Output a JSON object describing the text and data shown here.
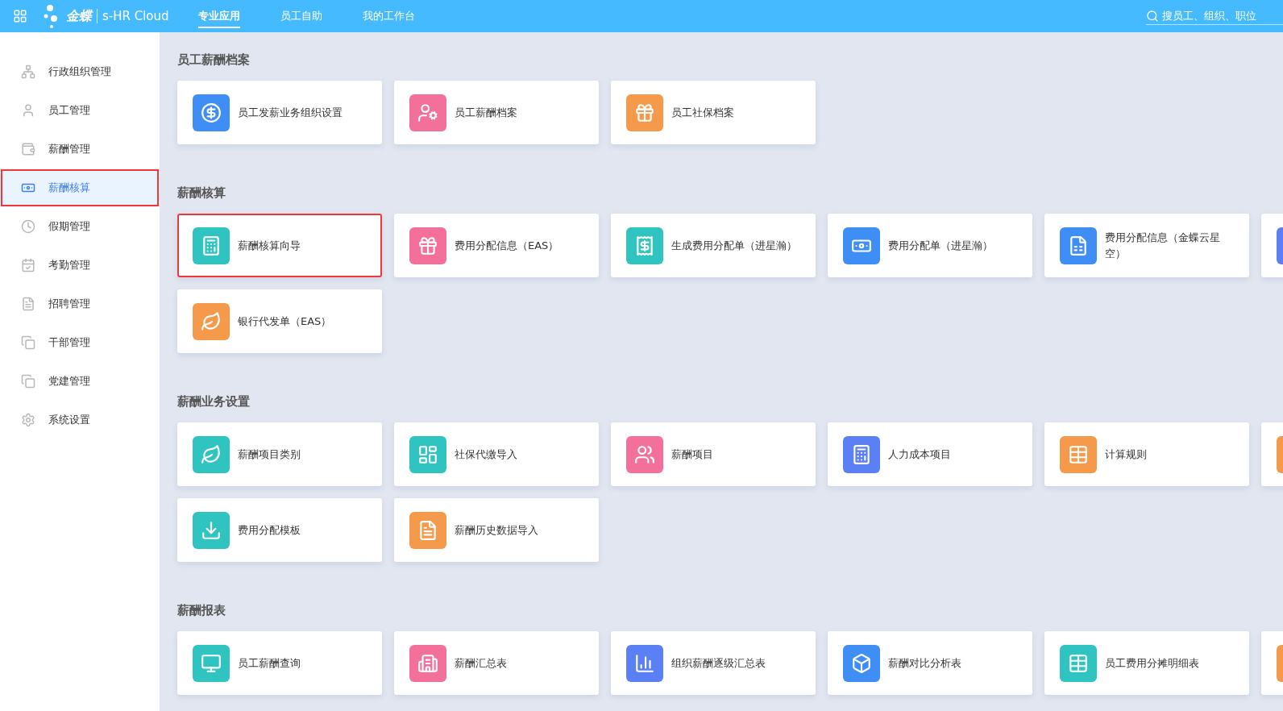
{
  "header": {
    "logo_brand": "金蝶",
    "logo_product": "s-HR Cloud",
    "tabs": [
      {
        "label": "专业应用",
        "selected": true
      },
      {
        "label": "员工自助",
        "selected": false
      },
      {
        "label": "我的工作台",
        "selected": false
      }
    ],
    "search": {
      "placeholder": "搜员工、组织、职位"
    }
  },
  "sidebar": {
    "items": [
      {
        "label": "行政组织管理",
        "selected": false,
        "highlighted": false
      },
      {
        "label": "员工管理",
        "selected": false,
        "highlighted": false
      },
      {
        "label": "薪酬管理",
        "selected": false,
        "highlighted": false
      },
      {
        "label": "薪酬核算",
        "selected": true,
        "highlighted": true
      },
      {
        "label": "假期管理",
        "selected": false,
        "highlighted": false
      },
      {
        "label": "考勤管理",
        "selected": false,
        "highlighted": false
      },
      {
        "label": "招聘管理",
        "selected": false,
        "highlighted": false
      },
      {
        "label": "干部管理",
        "selected": false,
        "highlighted": false
      },
      {
        "label": "党建管理",
        "selected": false,
        "highlighted": false
      },
      {
        "label": "系统设置",
        "selected": false,
        "highlighted": false
      }
    ]
  },
  "sections": [
    {
      "title": "员工薪酬档案",
      "cards": [
        {
          "kind": "app",
          "label": "员工发薪业务组织设置",
          "color": "#3f8ef5",
          "highlighted": false
        },
        {
          "kind": "app",
          "label": "员工薪酬档案",
          "color": "#f2709a",
          "highlighted": false
        },
        {
          "kind": "app",
          "label": "员工社保档案",
          "color": "#f5994a",
          "highlighted": false
        }
      ]
    },
    {
      "title": "薪酬核算",
      "cards": [
        {
          "kind": "app",
          "label": "薪酬核算向导",
          "color": "#2fc4c0",
          "highlighted": true
        },
        {
          "kind": "app",
          "label": "费用分配信息（EAS）",
          "color": "#f2709a",
          "highlighted": false
        },
        {
          "kind": "app",
          "label": "生成费用分配单（进星瀚）",
          "color": "#2fc4c0",
          "highlighted": false
        },
        {
          "kind": "app",
          "label": "费用分配单（进星瀚）",
          "color": "#3f8ef5",
          "highlighted": false
        },
        {
          "kind": "app",
          "label": "费用分配信息（金蝶云星空）",
          "color": "#3f8ef5",
          "highlighted": false
        },
        {
          "kind": "clipped",
          "color": "#5b7ff5",
          "highlighted": false
        },
        {
          "kind": "app",
          "label": "银行代发单（EAS）",
          "color": "#f5994a",
          "highlighted": false
        }
      ]
    },
    {
      "title": "薪酬业务设置",
      "cards": [
        {
          "kind": "app",
          "label": "薪酬项目类别",
          "color": "#2fc4c0",
          "highlighted": false
        },
        {
          "kind": "app",
          "label": "社保代缴导入",
          "color": "#2fc4c0",
          "highlighted": false
        },
        {
          "kind": "app",
          "label": "薪酬项目",
          "color": "#f2709a",
          "highlighted": false
        },
        {
          "kind": "app",
          "label": "人力成本项目",
          "color": "#5b7ff5",
          "highlighted": false
        },
        {
          "kind": "app",
          "label": "计算规则",
          "color": "#f5994a",
          "highlighted": false
        },
        {
          "kind": "clipped",
          "color": "#f5994a",
          "highlighted": false
        },
        {
          "kind": "app",
          "label": "费用分配模板",
          "color": "#2fc4c0",
          "highlighted": false
        },
        {
          "kind": "app",
          "label": "薪酬历史数据导入",
          "color": "#f5994a",
          "highlighted": false
        }
      ]
    },
    {
      "title": "薪酬报表",
      "cards": [
        {
          "kind": "app",
          "label": "员工薪酬查询",
          "color": "#2fc4c0",
          "highlighted": false
        },
        {
          "kind": "app",
          "label": "薪酬汇总表",
          "color": "#f2709a",
          "highlighted": false
        },
        {
          "kind": "app",
          "label": "组织薪酬逐级汇总表",
          "color": "#5b7ff5",
          "highlighted": false
        },
        {
          "kind": "app",
          "label": "薪酬对比分析表",
          "color": "#3f8ef5",
          "highlighted": false
        },
        {
          "kind": "app",
          "label": "员工费用分摊明细表",
          "color": "#2fc4c0",
          "highlighted": false
        },
        {
          "kind": "clipped",
          "color": "#f5994a",
          "highlighted": false
        }
      ]
    }
  ]
}
